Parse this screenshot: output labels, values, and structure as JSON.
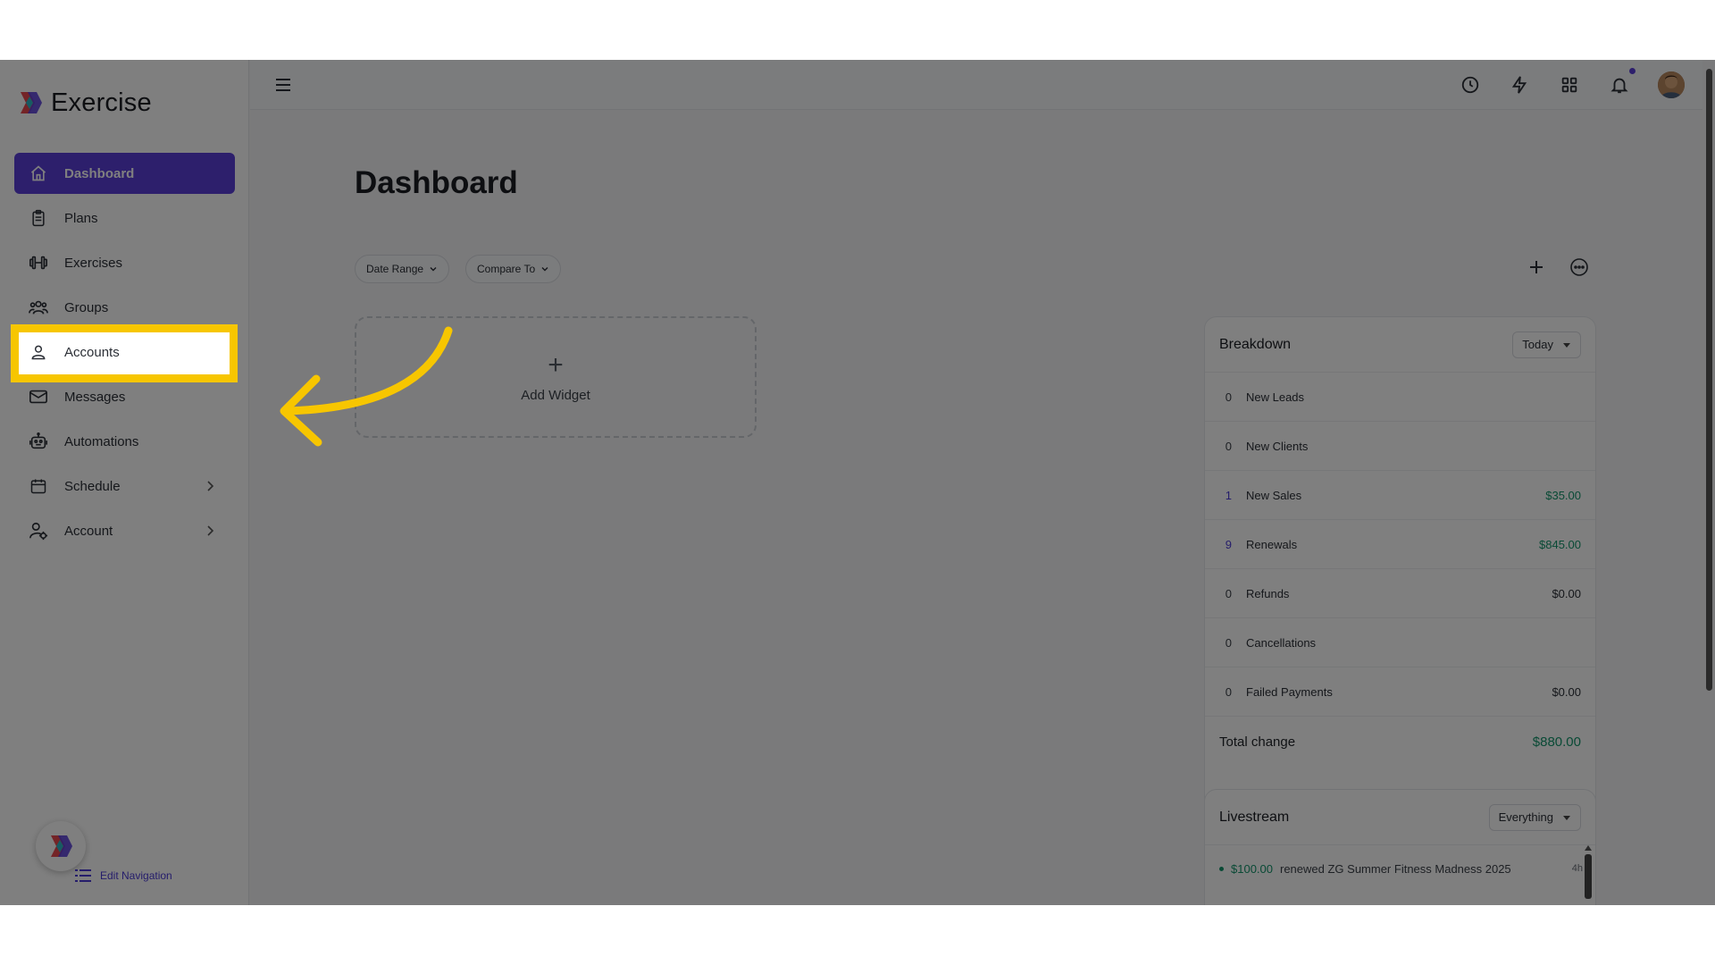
{
  "app": {
    "name": "Exercise"
  },
  "sidebar": {
    "items": [
      {
        "label": "Dashboard",
        "icon": "home-icon",
        "active": true
      },
      {
        "label": "Plans",
        "icon": "clipboard-icon"
      },
      {
        "label": "Exercises",
        "icon": "dumbbell-icon"
      },
      {
        "label": "Groups",
        "icon": "users-icon"
      },
      {
        "label": "Accounts",
        "icon": "user-icon",
        "highlighted": true
      },
      {
        "label": "Messages",
        "icon": "mail-icon"
      },
      {
        "label": "Automations",
        "icon": "robot-icon"
      },
      {
        "label": "Schedule",
        "icon": "calendar-icon",
        "expandable": true
      },
      {
        "label": "Account",
        "icon": "user-gear-icon",
        "expandable": true
      }
    ],
    "edit_navigation": "Edit Navigation"
  },
  "main": {
    "title": "Dashboard",
    "filters": {
      "date_range": "Date Range",
      "compare_to": "Compare To"
    },
    "add_widget": "Add Widget"
  },
  "breakdown": {
    "title": "Breakdown",
    "period": "Today",
    "rows": [
      {
        "count": "0",
        "label": "New Leads",
        "amount": ""
      },
      {
        "count": "0",
        "label": "New Clients",
        "amount": ""
      },
      {
        "count": "1",
        "label": "New Sales",
        "amount": "$35.00"
      },
      {
        "count": "9",
        "label": "Renewals",
        "amount": "$845.00"
      },
      {
        "count": "0",
        "label": "Refunds",
        "amount": "$0.00"
      },
      {
        "count": "0",
        "label": "Cancellations",
        "amount": ""
      },
      {
        "count": "0",
        "label": "Failed Payments",
        "amount": "$0.00"
      }
    ],
    "total_label": "Total change",
    "total_amount": "$880.00"
  },
  "livestream": {
    "title": "Livestream",
    "filter": "Everything",
    "entries": [
      {
        "amount": "$100.00",
        "text": "renewed ZG Summer Fitness Madness 2025",
        "time": "4h"
      }
    ]
  },
  "colors": {
    "brand": "#5b3fd9",
    "highlight": "#f7c600",
    "positive": "#12946b"
  }
}
